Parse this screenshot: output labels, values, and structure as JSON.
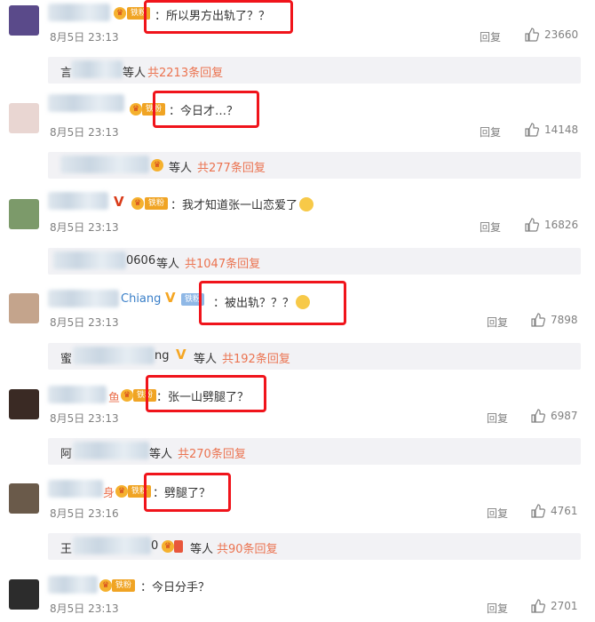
{
  "comments": [
    {
      "text": "：所以男方出轨了？？",
      "time": "8月5日 23:13",
      "reply": "回复",
      "likes": "23660"
    },
    {
      "text": "：今日才…？",
      "time": "8月5日 23:13",
      "reply": "回复",
      "likes": "14148"
    },
    {
      "text": "：我才知道张一山恋爱了",
      "time": "8月5日 23:13",
      "reply": "回复",
      "likes": "16826"
    },
    {
      "name_tail": "Chiang",
      "text": "：被出轨？？？",
      "time": "8月5日 23:13",
      "reply": "回复",
      "likes": "7898"
    },
    {
      "name_tail": "鱼",
      "text": "：张一山劈腿了？",
      "time": "8月5日 23:13",
      "reply": "回复",
      "likes": "6987"
    },
    {
      "name_tail": "身",
      "text": "：劈腿了？",
      "time": "8月5日 23:16",
      "reply": "回复",
      "likes": "4761"
    },
    {
      "text": "：今日分手？",
      "time": "8月5日 23:13",
      "reply": "回复",
      "likes": "2701"
    }
  ],
  "sub_replies": [
    {
      "prefix": "言",
      "mid": "等人",
      "count_link": "共2213条回复"
    },
    {
      "prefix": "",
      "mid": "等人",
      "count_link": "共277条回复"
    },
    {
      "prefix": "0606",
      "mid": "等人",
      "count_link": "共1047条回复"
    },
    {
      "prefix": "蜜",
      "tail": "ng",
      "mid": "等人",
      "count_link": "共192条回复"
    },
    {
      "prefix": "阿",
      "mid": "等人",
      "count_link": "共270条回复"
    },
    {
      "prefix": "王",
      "tail": "0",
      "mid": "等人",
      "count_link": "共90条回复"
    }
  ],
  "badges": {
    "fan": "铁粉",
    "v": "V"
  },
  "colors": {
    "highlight_box": "#f0141b",
    "link": "#eb7350",
    "sub_bar_bg": "#f2f2f5"
  }
}
